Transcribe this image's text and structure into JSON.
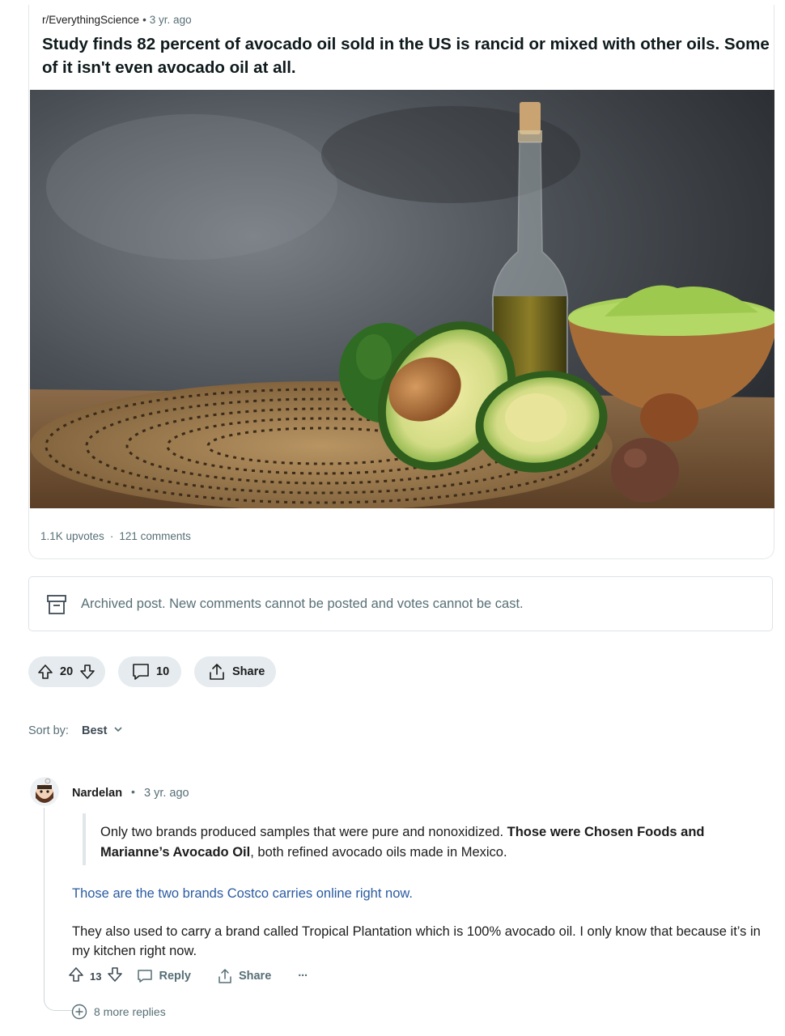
{
  "post": {
    "subreddit": "r/EverythingScience",
    "age": "3 yr. ago",
    "title": "Study finds 82 percent of avocado oil sold in the US is rancid or mixed with other oils. Some of it isn't even avocado oil at all.",
    "upvotes": "1.1K upvotes",
    "comments": "121 comments"
  },
  "archived": {
    "text": "Archived post. New comments cannot be posted and votes cannot be cast."
  },
  "actions": {
    "score": "20",
    "comment_count": "10",
    "share_label": "Share"
  },
  "sort": {
    "label": "Sort by:",
    "value": "Best"
  },
  "comment": {
    "author": "Nardelan",
    "age": "3 yr. ago",
    "quote_plain": "Only two brands produced samples that were pure and nonoxidized. ",
    "quote_bold": "Those were Chosen Foods and Marianne’s Avocado Oil",
    "quote_tail": ", both refined avocado oils made in Mexico.",
    "link_text": "Those are the two brands Costco carries online right now.",
    "paragraph": "They also used to carry a brand called Tropical Plantation which is 100% avocado oil. I only know that because it’s in my kitchen right now.",
    "score": "13",
    "reply_label": "Reply",
    "share_label": "Share",
    "more_label": "···"
  },
  "more_replies": "8 more replies",
  "colors": {
    "link": "#2a5ba1",
    "muted": "#576f76",
    "pill": "#e5ebee"
  }
}
